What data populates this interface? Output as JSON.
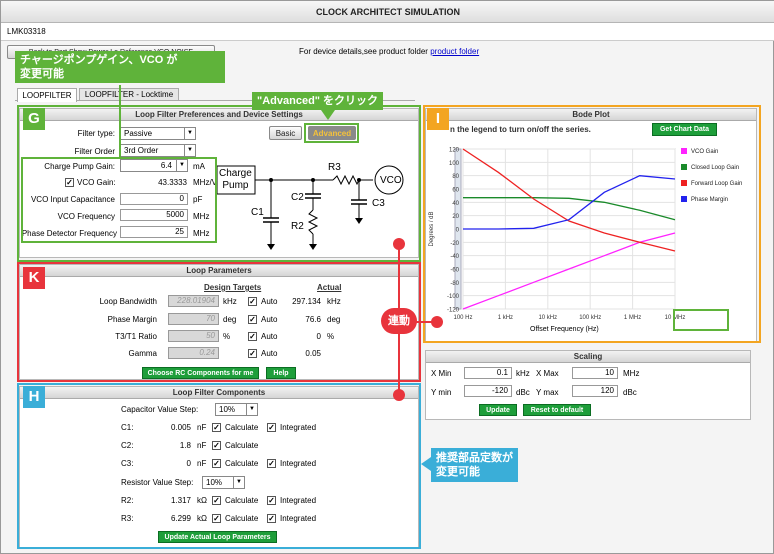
{
  "app": {
    "title": "CLOCK ARCHITECT SIMULATION",
    "part": "LMK03318"
  },
  "top": {
    "hidden_buttons": "Back to Part  Show Power Lo  Reference  VCO NOISE",
    "details_text": "For device details,see product folder",
    "details_link": "product folder"
  },
  "tabs": [
    {
      "label": "LOOPFILTER"
    },
    {
      "label": "LOOPFILTER - Locktime"
    }
  ],
  "annotations": {
    "g_callout": "チャージポンプゲイン、VCO が\n変更可能",
    "advanced_callout": "\"Advanced\" をクリック",
    "link_label": "連動",
    "h_callout": "推奨部品定数が\n変更可能",
    "letters": {
      "g": "G",
      "i": "I",
      "k": "K",
      "h": "H"
    },
    "colors": {
      "green": "#5fb33a",
      "orange": "#f3a521",
      "red": "#e8343c",
      "blue": "#3aaed8"
    }
  },
  "prefs": {
    "title": "Loop Filter Preferences and Device Settings",
    "filter_type_label": "Filter type:",
    "filter_type": "Passive",
    "filter_order_label": "Filter Order",
    "filter_order": "3rd Order",
    "basic": "Basic",
    "advanced": "Advanced",
    "cp_gain_label": "Charge Pump Gain:",
    "cp_gain": "6.4",
    "cp_unit": "mA",
    "vco_gain_label": "VCO Gain:",
    "vco_gain": "43.3333",
    "vco_unit": "MHz/V",
    "vco_cap_label": "VCO Input Capacitance",
    "vco_cap": "0",
    "vco_cap_unit": "pF",
    "vco_freq_label": "VCO Frequency",
    "vco_freq": "5000",
    "vco_freq_unit": "MHz",
    "pd_freq_label": "Phase Detector Frequency",
    "pd_freq": "25",
    "pd_unit": "MHz",
    "schem": {
      "cp": "Charge\nPump",
      "r3": "R3",
      "c2": "C2",
      "r2": "R2",
      "c1": "C1",
      "c3": "C3",
      "vco": "VCO"
    }
  },
  "params": {
    "title": "Loop Parameters",
    "design_hdr": "Design Targets",
    "actual_hdr": "Actual",
    "rows": [
      {
        "label": "Loop Bandwidth",
        "target": "228.01904",
        "unit": "kHz",
        "auto": "Auto",
        "actual": "297.134",
        "aunit": "kHz"
      },
      {
        "label": "Phase Margin",
        "target": "70",
        "unit": "deg",
        "auto": "Auto",
        "actual": "76.6",
        "aunit": "deg"
      },
      {
        "label": "T3/T1 Ratio",
        "target": "50",
        "unit": "%",
        "auto": "Auto",
        "actual": "0",
        "aunit": "%"
      },
      {
        "label": "Gamma",
        "target": "0.24",
        "unit": "",
        "auto": "Auto",
        "actual": "0.05",
        "aunit": ""
      }
    ],
    "choose_btn": "Choose RC Components for me",
    "help_btn": "Help"
  },
  "components": {
    "title": "Loop Filter Components",
    "cap_step_label": "Capacitor Value Step:",
    "cap_step": "10%",
    "caps": [
      {
        "label": "C1:",
        "value": "0.005",
        "unit": "nF",
        "calc": "Calculate",
        "integ": "Integrated"
      },
      {
        "label": "C2:",
        "value": "1.8",
        "unit": "nF",
        "calc": "Calculate",
        "integ": ""
      },
      {
        "label": "C3:",
        "value": "0",
        "unit": "nF",
        "calc": "Calculate",
        "integ": "Integrated"
      }
    ],
    "res_step_label": "Resistor Value Step:",
    "res_step": "10%",
    "res": [
      {
        "label": "R2:",
        "value": "1.317",
        "unit": "kΩ",
        "calc": "Calculate",
        "integ": "Integrated"
      },
      {
        "label": "R3:",
        "value": "6.299",
        "unit": "kΩ",
        "calc": "Calculate",
        "integ": "Integrated"
      }
    ],
    "update_btn": "Update Actual Loop Parameters"
  },
  "bode": {
    "title": "Bode Plot",
    "hint": "n the legend to turn on/off the series.",
    "get_btn": "Get Chart Data"
  },
  "chart_data": {
    "type": "line",
    "xlabel": "Offset Frequency (Hz)",
    "ylabel": "Degrees / dB",
    "x": [
      "100 Hz",
      "1 kHz",
      "10 kHz",
      "100 kHz",
      "1 MHz",
      "10 MHz"
    ],
    "ylim": [
      -120,
      120
    ],
    "yticks": [
      "120",
      "100",
      "80",
      "60",
      "40",
      "20",
      "0",
      "-20",
      "-40",
      "-60",
      "-80",
      "-100",
      "-120"
    ],
    "grid": true,
    "legend": "right",
    "series": [
      {
        "name": "VCO Gain",
        "color": "#ff22ff",
        "values": [
          -120,
          -100,
          -80,
          -60,
          -40,
          -20,
          -6
        ]
      },
      {
        "name": "Closed Loop Gain",
        "color": "#1a8a2a",
        "values": [
          47,
          47,
          47,
          46,
          40,
          28,
          14
        ]
      },
      {
        "name": "Forward Loop Gain",
        "color": "#ee2222",
        "values": [
          125,
          85,
          45,
          12,
          -6,
          -20,
          -33
        ]
      },
      {
        "name": "Phase Margin",
        "color": "#2222ee",
        "values": [
          0,
          0,
          1,
          14,
          55,
          80,
          75
        ]
      }
    ]
  },
  "scaling": {
    "title": "Scaling",
    "xmin_label": "X Min",
    "xmin": "0.1",
    "xmin_unit": "kHz",
    "xmax_label": "X Max",
    "xmax": "10",
    "xmax_unit": "MHz",
    "ymin_label": "Y min",
    "ymin": "-120",
    "ymin_unit": "dBc",
    "ymax_label": "Y max",
    "ymax": "120",
    "ymax_unit": "dBc",
    "update_btn": "Update",
    "reset_btn": "Reset to default"
  }
}
